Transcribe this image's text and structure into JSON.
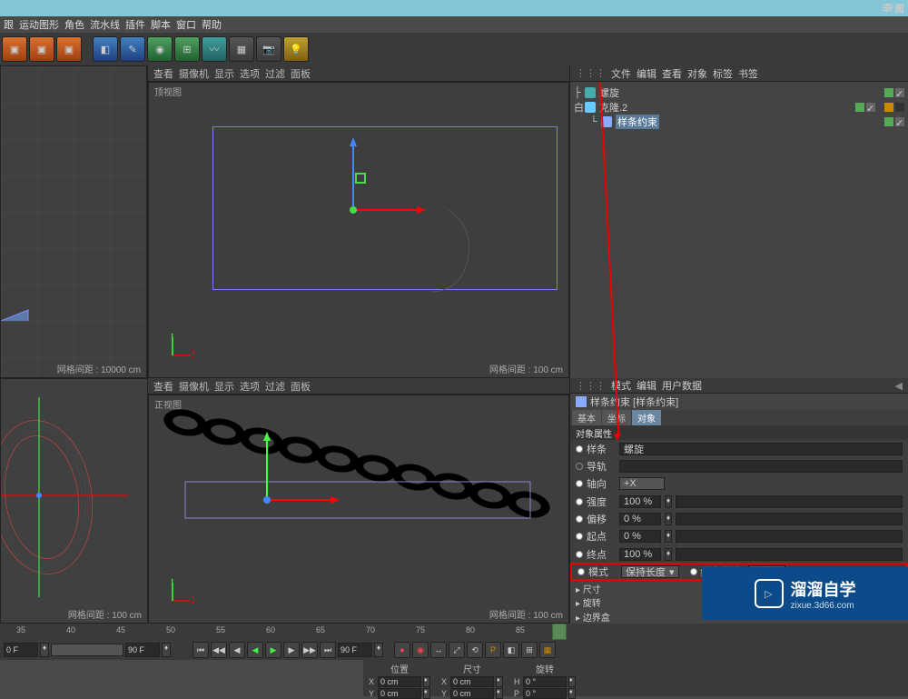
{
  "title_right": "界面",
  "menu": [
    "跟",
    "运动图形",
    "角色",
    "流水线",
    "插件",
    "脚本",
    "窗口",
    "帮助"
  ],
  "obj_tabs": [
    "文件",
    "编辑",
    "查看",
    "对象",
    "标签",
    "书签"
  ],
  "tree": {
    "item1": "螺旋",
    "item2": "克隆.2",
    "item3": "样条约束"
  },
  "viewports": {
    "tabs": [
      "查看",
      "摄像机",
      "显示",
      "选项",
      "过滤",
      "面板"
    ],
    "top_label": "顶视图",
    "front_label": "正视图",
    "grid_10000": "网格间距 : 10000 cm",
    "grid_100": "网格间距 : 100 cm"
  },
  "attr": {
    "header": [
      "模式",
      "编辑",
      "用户数据"
    ],
    "title": "样条约束 [样条约束]",
    "tabs": [
      "基本",
      "坐标",
      "对象"
    ],
    "section": "对象属性",
    "spline_lbl": "样条",
    "spline_val": "螺旋",
    "rail_lbl": "导轨",
    "axis_lbl": "轴向",
    "axis_val": "+X",
    "strength_lbl": "强度",
    "strength_val": "100 %",
    "offset_lbl": "偏移",
    "offset_val": "0 %",
    "start_lbl": "起点",
    "start_val": "0 %",
    "end_lbl": "终点",
    "end_val": "100 %",
    "mode_lbl": "模式",
    "mode_val": "保持长度",
    "endmode_lbl": "结束模式",
    "endmode_val": "延伸",
    "collapse1": "▸ 尺寸",
    "collapse2": "▸ 旋转",
    "collapse3": "▸ 边界盒"
  },
  "timeline": {
    "ticks": [
      "35",
      "40",
      "45",
      "50",
      "55",
      "60",
      "65",
      "70",
      "75",
      "80",
      "85",
      "90"
    ],
    "start": "0 F",
    "cur": "90 F",
    "end": "90 F"
  },
  "coords": {
    "pos": "位置",
    "size": "尺寸",
    "rot": "旋转",
    "x": "X",
    "y": "Y",
    "xval": "0 cm",
    "yval": "0 cm",
    "sxval": "0 cm",
    "syval": "0 cm",
    "hval": "0 °",
    "pval": "0 °",
    "hlbl": "H",
    "plbl": "P"
  },
  "watermark": {
    "big": "溜溜自学",
    "small": "zixue.3d66.com"
  }
}
